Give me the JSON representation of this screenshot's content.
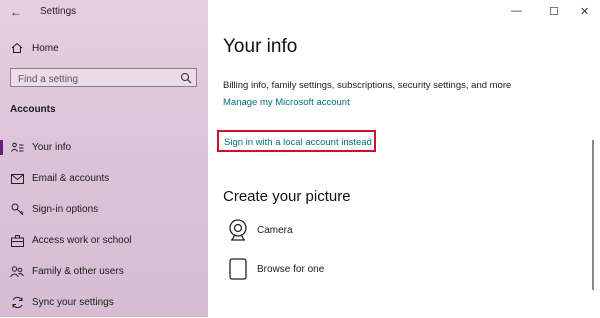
{
  "window": {
    "title": "Settings",
    "controls": {
      "minimize": "—",
      "maximize": "☐",
      "close": "✕"
    }
  },
  "sidebar": {
    "home_label": "Home",
    "search_placeholder": "Find a setting",
    "section_title": "Accounts",
    "items": [
      {
        "label": "Your info",
        "icon": "person-card-icon",
        "active": true
      },
      {
        "label": "Email & accounts",
        "icon": "mail-icon"
      },
      {
        "label": "Sign-in options",
        "icon": "key-icon"
      },
      {
        "label": "Access work or school",
        "icon": "briefcase-icon"
      },
      {
        "label": "Family & other users",
        "icon": "people-icon"
      },
      {
        "label": "Sync your settings",
        "icon": "sync-icon"
      }
    ]
  },
  "main": {
    "title": "Your info",
    "description": "Billing info, family settings, subscriptions, security settings, and more",
    "manage_link": "Manage my Microsoft account",
    "local_link": "Sign in with a local account instead",
    "picture_title": "Create your picture",
    "options": [
      {
        "label": "Camera",
        "icon": "camera-icon"
      },
      {
        "label": "Browse for one",
        "icon": "browse-icon"
      }
    ]
  },
  "colors": {
    "accent": "#6b1f7a",
    "link": "#00727a",
    "highlight_box": "#d0102a"
  }
}
